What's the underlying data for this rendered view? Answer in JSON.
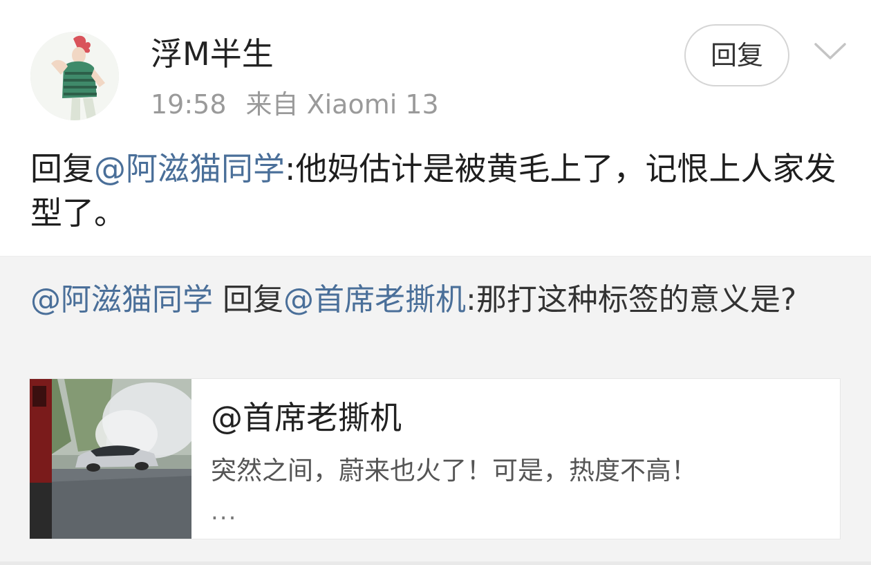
{
  "post": {
    "username": "浮M半生",
    "time": "19:58",
    "source": "来自 Xiaomi 13",
    "reply_button": "回复",
    "avatar_icon": "avatar-character-icon",
    "menu_icon": "chevron-down-icon",
    "content": {
      "prefix": "回复",
      "mention": "@阿滋猫同学",
      "text": ":他妈估计是被黄毛上了，记恨上人家发型了。"
    }
  },
  "quote": {
    "author": "@阿滋猫同学",
    "reply_word": "回复",
    "mention": "@首席老撕机",
    "text": ":那打这种标签的意义是?",
    "card": {
      "title": "@首席老撕机",
      "description": "突然之间，蔚来也火了！可是，热度不高！",
      "more": "..."
    }
  },
  "colors": {
    "mention": "#4a6f99",
    "quote_background": "#f3f3f3",
    "meta_text": "#9a9a9a"
  }
}
